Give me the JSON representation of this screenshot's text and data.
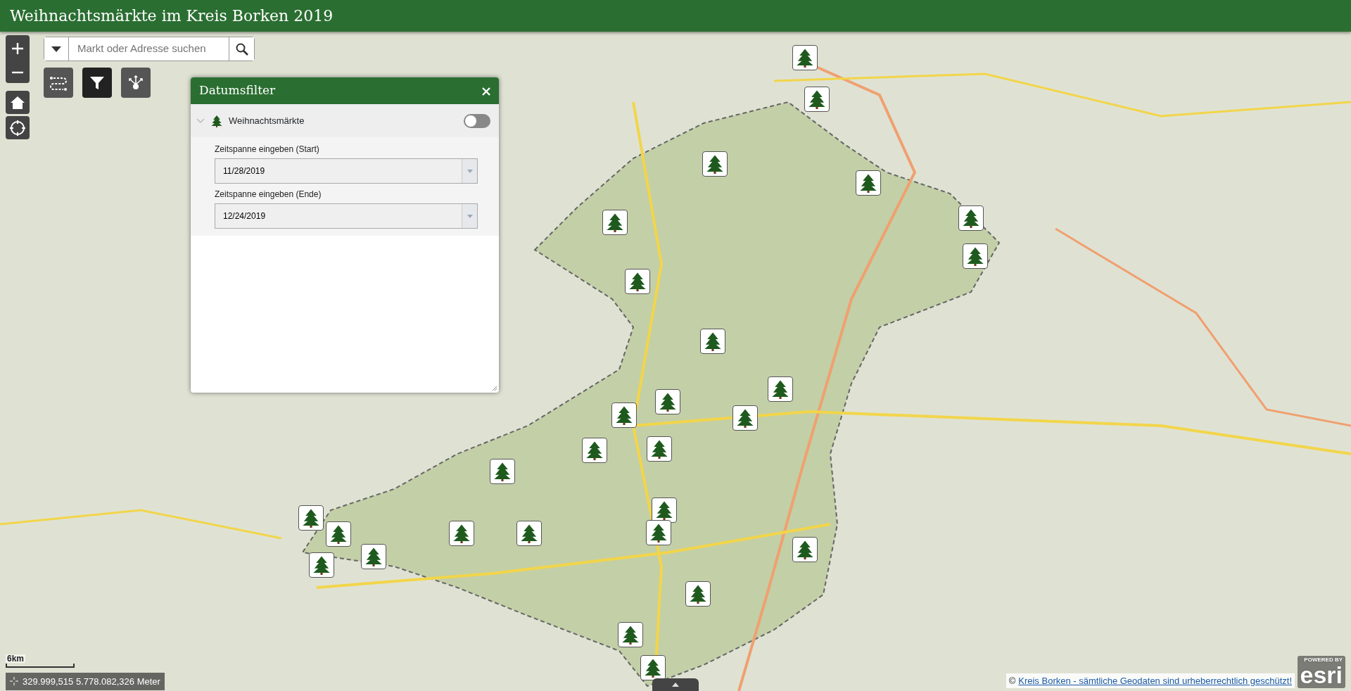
{
  "app": {
    "title": "Weihnachtsmärkte im Kreis Borken 2019"
  },
  "search": {
    "placeholder": "Markt oder Adresse suchen"
  },
  "toolbar": [
    {
      "kind": "directions",
      "selected": false
    },
    {
      "kind": "filter",
      "selected": true
    },
    {
      "kind": "share",
      "selected": false
    }
  ],
  "filter_panel": {
    "title": "Datumsfilter",
    "layer": {
      "name": "Weihnachtsmärkte",
      "on": false
    },
    "fields": [
      {
        "label": "Zeitspanne eingeben (Start)",
        "value": "11/28/2019"
      },
      {
        "label": "Zeitspanne eingeben (Ende)",
        "value": "12/24/2019"
      }
    ]
  },
  "scale_bar": {
    "label": "6km"
  },
  "coordinates": "329.999,515 5.778.082,326 Meter",
  "attribution": {
    "prefix": "©",
    "link": "Kreis Borken - sämtliche Geodaten sind urheberrechtlich geschützt!"
  },
  "logo": {
    "caption": "POWERED BY",
    "name": "esri"
  }
}
